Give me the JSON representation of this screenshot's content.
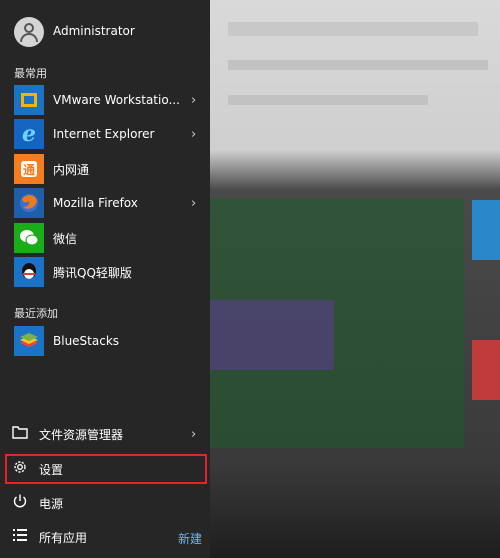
{
  "user": {
    "name": "Administrator",
    "avatar_icon": "user-icon"
  },
  "most_used": {
    "heading": "最常用",
    "apps": [
      {
        "label": "VMware Workstatio...",
        "icon": "vmware-icon",
        "color": "#1a73c7",
        "has_submenu": true
      },
      {
        "label": "Internet Explorer",
        "icon": "internet-explorer-icon",
        "color": "#1565c0",
        "has_submenu": true
      },
      {
        "label": "内网通",
        "icon": "neiwangtong-icon",
        "color": "#f57c1f",
        "has_submenu": false
      },
      {
        "label": "Mozilla Firefox",
        "icon": "firefox-icon",
        "color": "#1f5ea8",
        "has_submenu": true
      },
      {
        "label": "微信",
        "icon": "wechat-icon",
        "color": "#1aad19",
        "has_submenu": false
      },
      {
        "label": "腾讯QQ轻聊版",
        "icon": "qq-icon",
        "color": "#1a73c7",
        "has_submenu": false
      }
    ]
  },
  "recently_added": {
    "heading": "最近添加",
    "apps": [
      {
        "label": "BlueStacks",
        "icon": "bluestacks-icon",
        "color": "#1a73c7"
      }
    ]
  },
  "system": {
    "file_explorer": {
      "label": "文件资源管理器",
      "icon": "file-explorer-icon"
    },
    "settings": {
      "label": "设置",
      "icon": "gear-icon",
      "highlighted": true,
      "highlight_color": "#e52424"
    },
    "power": {
      "label": "电源",
      "icon": "power-icon"
    },
    "all_apps": {
      "label": "所有应用",
      "icon": "list-icon",
      "new_label": "新建"
    }
  },
  "chevron": "›"
}
